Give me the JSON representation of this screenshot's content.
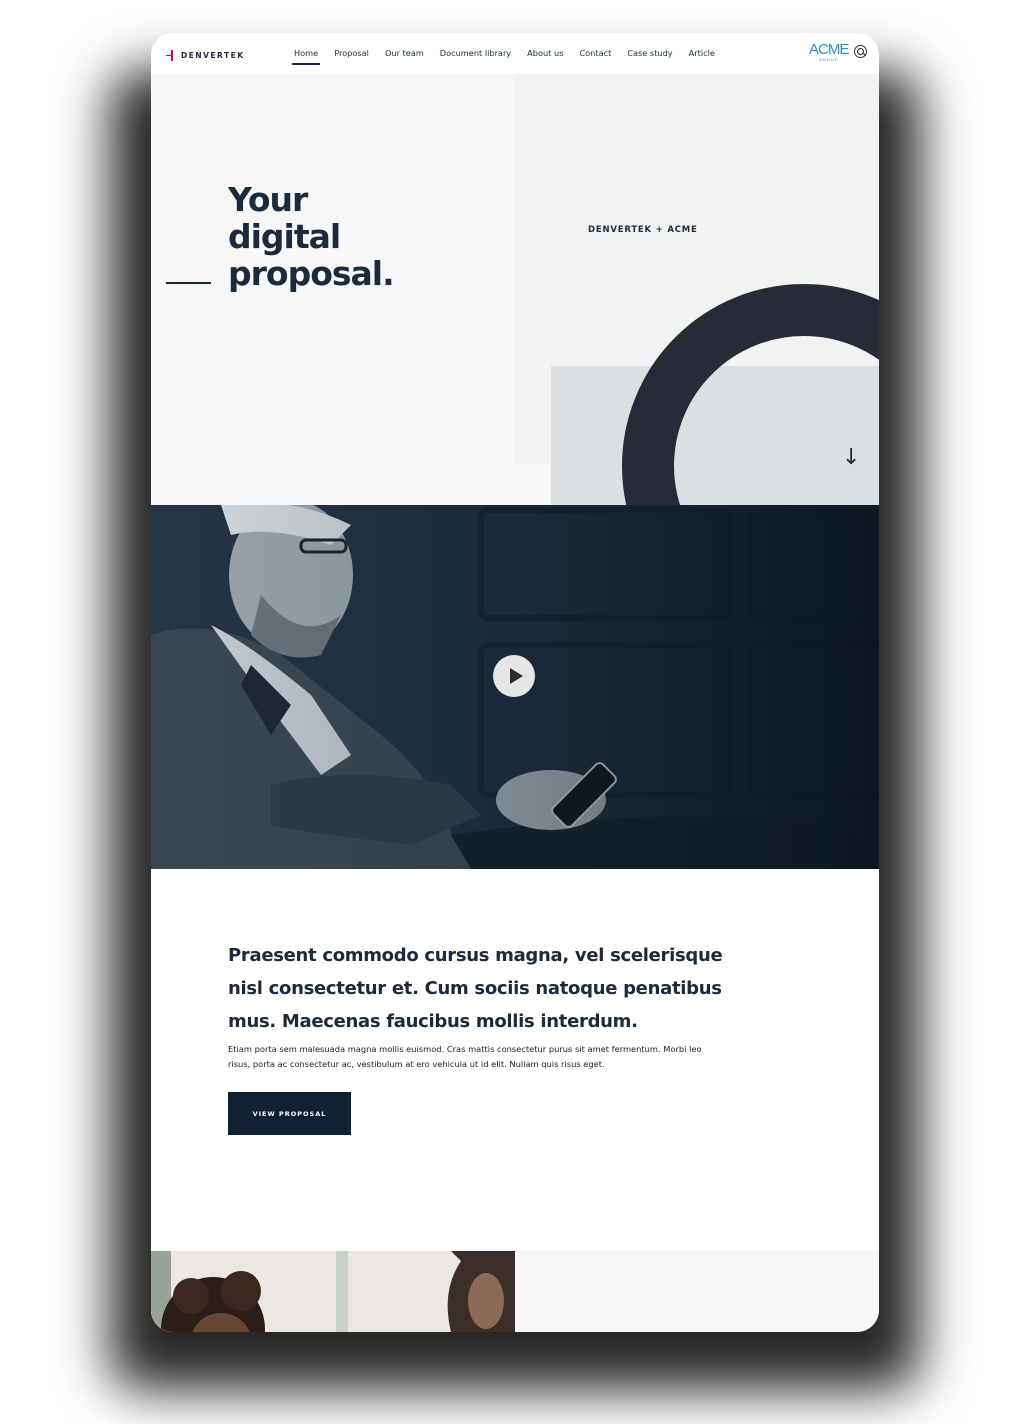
{
  "nav": {
    "logo_text": "DENVERTEK",
    "items": [
      {
        "label": "Home",
        "active": true
      },
      {
        "label": "Proposal"
      },
      {
        "label": "Our team"
      },
      {
        "label": "Document library"
      },
      {
        "label": "About us"
      },
      {
        "label": "Contact"
      },
      {
        "label": "Case study"
      },
      {
        "label": "Article"
      }
    ],
    "partner_logo": "ACME",
    "partner_logo_sub": "GROUP",
    "search_icon": "search-icon"
  },
  "hero": {
    "title_lines": [
      "Your",
      "digital",
      "proposal."
    ],
    "partner_label": "DENVERTEK + ACME",
    "scroll_icon": "arrow-down-icon"
  },
  "video": {
    "play_icon": "play-icon"
  },
  "intro": {
    "lead": "Praesent commodo cursus magna, vel scelerisque nisl consectetur et. Cum sociis natoque penatibus mus. Maecenas faucibus mollis interdum.",
    "body": "Etiam porta sem malesuada magna mollis euismod. Cras mattis consectetur purus sit amet fermentum. Morbi leo risus, porta ac consectetur ac, vestibulum at ero vehicula ut id elit. Nullam quis risus eget.",
    "cta_label": "VIEW PROPOSAL"
  },
  "colors": {
    "navy": "#1b2a3d",
    "brand_red": "#e4003b",
    "acme_blue": "#2a8ec6",
    "button_dark": "#0f2133"
  }
}
